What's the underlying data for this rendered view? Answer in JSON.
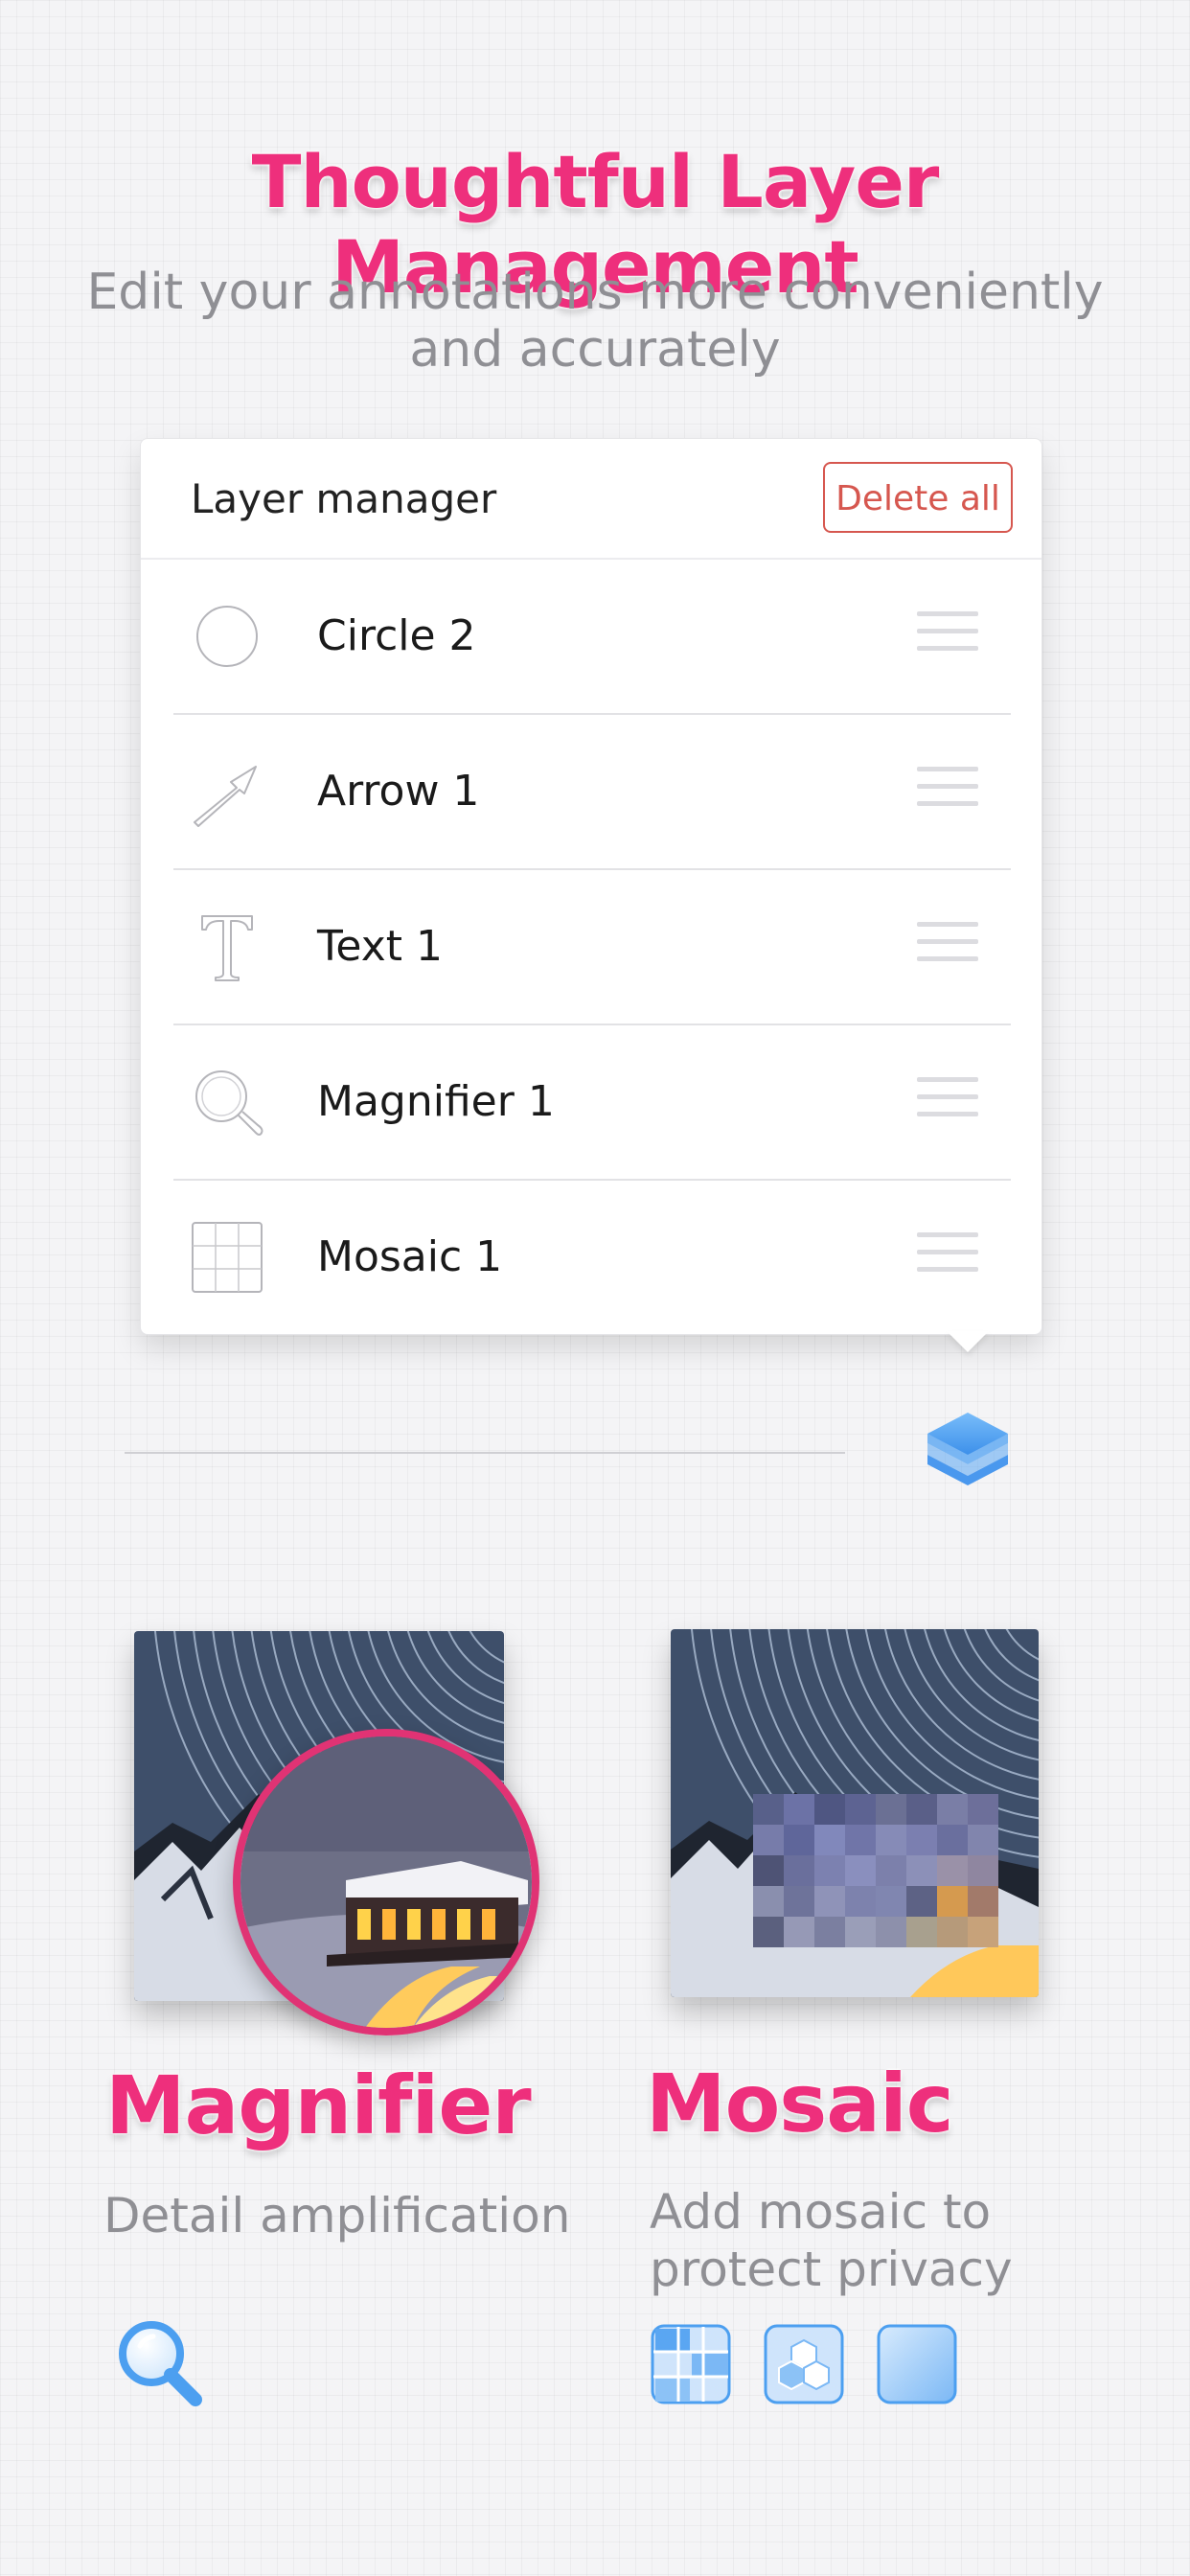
{
  "headline": "Thoughtful Layer Management",
  "subhead_line1": "Edit your annotations more conveniently",
  "subhead_line2": "and accurately",
  "layer_manager": {
    "title": "Layer manager",
    "delete_all_label": "Delete all",
    "layers": [
      {
        "label": "Circle 2",
        "icon": "circle-icon"
      },
      {
        "label": "Arrow 1",
        "icon": "arrow-icon"
      },
      {
        "label": "Text 1",
        "icon": "text-icon"
      },
      {
        "label": "Magnifier 1",
        "icon": "magnifier-icon"
      },
      {
        "label": "Mosaic 1",
        "icon": "mosaic-icon"
      }
    ]
  },
  "layers_button_icon": "layers-icon",
  "features": {
    "magnifier": {
      "title": "Magnifier",
      "description": "Detail amplification",
      "tool_icons": [
        "magnifier-tool-icon"
      ]
    },
    "mosaic": {
      "title": "Mosaic",
      "description_line1": "Add mosaic to",
      "description_line2": "protect privacy",
      "tool_icons": [
        "mosaic-grid-icon",
        "mosaic-hexagon-icon",
        "mosaic-blur-icon"
      ]
    }
  },
  "colors": {
    "accent_pink": "#ee2f7c",
    "delete_red": "#d6574f",
    "icon_blue": "#4c9ff0",
    "subtitle_gray": "#8f8f94"
  }
}
